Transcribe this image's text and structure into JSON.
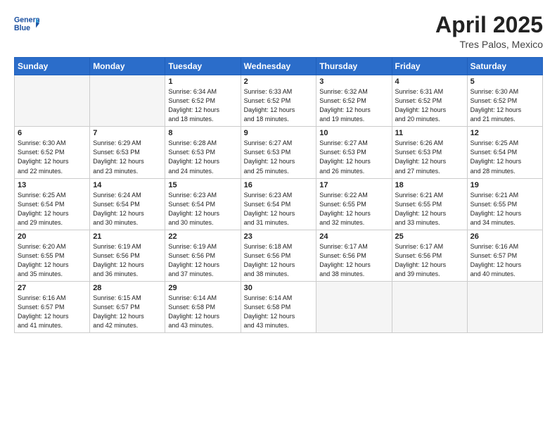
{
  "header": {
    "logo_line1": "General",
    "logo_line2": "Blue",
    "title": "April 2025",
    "location": "Tres Palos, Mexico"
  },
  "weekdays": [
    "Sunday",
    "Monday",
    "Tuesday",
    "Wednesday",
    "Thursday",
    "Friday",
    "Saturday"
  ],
  "weeks": [
    [
      {
        "num": "",
        "sunrise": "",
        "sunset": "",
        "daylight": "",
        "empty": true
      },
      {
        "num": "",
        "sunrise": "",
        "sunset": "",
        "daylight": "",
        "empty": true
      },
      {
        "num": "1",
        "sunrise": "Sunrise: 6:34 AM",
        "sunset": "Sunset: 6:52 PM",
        "daylight": "Daylight: 12 hours and 18 minutes."
      },
      {
        "num": "2",
        "sunrise": "Sunrise: 6:33 AM",
        "sunset": "Sunset: 6:52 PM",
        "daylight": "Daylight: 12 hours and 18 minutes."
      },
      {
        "num": "3",
        "sunrise": "Sunrise: 6:32 AM",
        "sunset": "Sunset: 6:52 PM",
        "daylight": "Daylight: 12 hours and 19 minutes."
      },
      {
        "num": "4",
        "sunrise": "Sunrise: 6:31 AM",
        "sunset": "Sunset: 6:52 PM",
        "daylight": "Daylight: 12 hours and 20 minutes."
      },
      {
        "num": "5",
        "sunrise": "Sunrise: 6:30 AM",
        "sunset": "Sunset: 6:52 PM",
        "daylight": "Daylight: 12 hours and 21 minutes."
      }
    ],
    [
      {
        "num": "6",
        "sunrise": "Sunrise: 6:30 AM",
        "sunset": "Sunset: 6:52 PM",
        "daylight": "Daylight: 12 hours and 22 minutes."
      },
      {
        "num": "7",
        "sunrise": "Sunrise: 6:29 AM",
        "sunset": "Sunset: 6:53 PM",
        "daylight": "Daylight: 12 hours and 23 minutes."
      },
      {
        "num": "8",
        "sunrise": "Sunrise: 6:28 AM",
        "sunset": "Sunset: 6:53 PM",
        "daylight": "Daylight: 12 hours and 24 minutes."
      },
      {
        "num": "9",
        "sunrise": "Sunrise: 6:27 AM",
        "sunset": "Sunset: 6:53 PM",
        "daylight": "Daylight: 12 hours and 25 minutes."
      },
      {
        "num": "10",
        "sunrise": "Sunrise: 6:27 AM",
        "sunset": "Sunset: 6:53 PM",
        "daylight": "Daylight: 12 hours and 26 minutes."
      },
      {
        "num": "11",
        "sunrise": "Sunrise: 6:26 AM",
        "sunset": "Sunset: 6:53 PM",
        "daylight": "Daylight: 12 hours and 27 minutes."
      },
      {
        "num": "12",
        "sunrise": "Sunrise: 6:25 AM",
        "sunset": "Sunset: 6:54 PM",
        "daylight": "Daylight: 12 hours and 28 minutes."
      }
    ],
    [
      {
        "num": "13",
        "sunrise": "Sunrise: 6:25 AM",
        "sunset": "Sunset: 6:54 PM",
        "daylight": "Daylight: 12 hours and 29 minutes."
      },
      {
        "num": "14",
        "sunrise": "Sunrise: 6:24 AM",
        "sunset": "Sunset: 6:54 PM",
        "daylight": "Daylight: 12 hours and 30 minutes."
      },
      {
        "num": "15",
        "sunrise": "Sunrise: 6:23 AM",
        "sunset": "Sunset: 6:54 PM",
        "daylight": "Daylight: 12 hours and 30 minutes."
      },
      {
        "num": "16",
        "sunrise": "Sunrise: 6:23 AM",
        "sunset": "Sunset: 6:54 PM",
        "daylight": "Daylight: 12 hours and 31 minutes."
      },
      {
        "num": "17",
        "sunrise": "Sunrise: 6:22 AM",
        "sunset": "Sunset: 6:55 PM",
        "daylight": "Daylight: 12 hours and 32 minutes."
      },
      {
        "num": "18",
        "sunrise": "Sunrise: 6:21 AM",
        "sunset": "Sunset: 6:55 PM",
        "daylight": "Daylight: 12 hours and 33 minutes."
      },
      {
        "num": "19",
        "sunrise": "Sunrise: 6:21 AM",
        "sunset": "Sunset: 6:55 PM",
        "daylight": "Daylight: 12 hours and 34 minutes."
      }
    ],
    [
      {
        "num": "20",
        "sunrise": "Sunrise: 6:20 AM",
        "sunset": "Sunset: 6:55 PM",
        "daylight": "Daylight: 12 hours and 35 minutes."
      },
      {
        "num": "21",
        "sunrise": "Sunrise: 6:19 AM",
        "sunset": "Sunset: 6:56 PM",
        "daylight": "Daylight: 12 hours and 36 minutes."
      },
      {
        "num": "22",
        "sunrise": "Sunrise: 6:19 AM",
        "sunset": "Sunset: 6:56 PM",
        "daylight": "Daylight: 12 hours and 37 minutes."
      },
      {
        "num": "23",
        "sunrise": "Sunrise: 6:18 AM",
        "sunset": "Sunset: 6:56 PM",
        "daylight": "Daylight: 12 hours and 38 minutes."
      },
      {
        "num": "24",
        "sunrise": "Sunrise: 6:17 AM",
        "sunset": "Sunset: 6:56 PM",
        "daylight": "Daylight: 12 hours and 38 minutes."
      },
      {
        "num": "25",
        "sunrise": "Sunrise: 6:17 AM",
        "sunset": "Sunset: 6:56 PM",
        "daylight": "Daylight: 12 hours and 39 minutes."
      },
      {
        "num": "26",
        "sunrise": "Sunrise: 6:16 AM",
        "sunset": "Sunset: 6:57 PM",
        "daylight": "Daylight: 12 hours and 40 minutes."
      }
    ],
    [
      {
        "num": "27",
        "sunrise": "Sunrise: 6:16 AM",
        "sunset": "Sunset: 6:57 PM",
        "daylight": "Daylight: 12 hours and 41 minutes."
      },
      {
        "num": "28",
        "sunrise": "Sunrise: 6:15 AM",
        "sunset": "Sunset: 6:57 PM",
        "daylight": "Daylight: 12 hours and 42 minutes."
      },
      {
        "num": "29",
        "sunrise": "Sunrise: 6:14 AM",
        "sunset": "Sunset: 6:58 PM",
        "daylight": "Daylight: 12 hours and 43 minutes."
      },
      {
        "num": "30",
        "sunrise": "Sunrise: 6:14 AM",
        "sunset": "Sunset: 6:58 PM",
        "daylight": "Daylight: 12 hours and 43 minutes."
      },
      {
        "num": "",
        "sunrise": "",
        "sunset": "",
        "daylight": "",
        "empty": true
      },
      {
        "num": "",
        "sunrise": "",
        "sunset": "",
        "daylight": "",
        "empty": true
      },
      {
        "num": "",
        "sunrise": "",
        "sunset": "",
        "daylight": "",
        "empty": true
      }
    ]
  ]
}
